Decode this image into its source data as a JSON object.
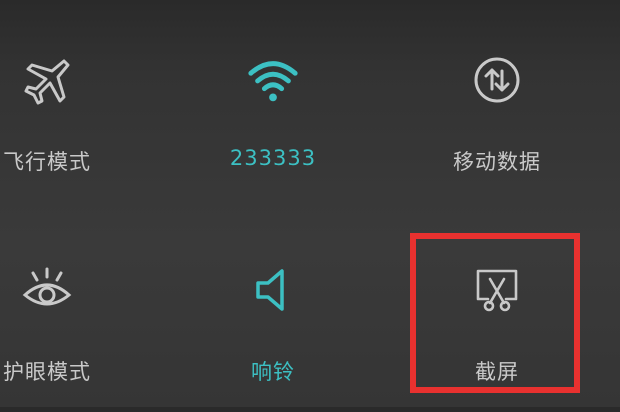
{
  "quick_settings": {
    "tiles": [
      {
        "label": "飞行模式",
        "icon": "airplane-icon",
        "active": false
      },
      {
        "label": "233333",
        "icon": "wifi-icon",
        "active": true
      },
      {
        "label": "移动数据",
        "icon": "mobile-data-icon",
        "active": false
      },
      {
        "label": "护眼模式",
        "icon": "eye-icon",
        "active": false
      },
      {
        "label": "响铃",
        "icon": "speaker-icon",
        "active": true
      },
      {
        "label": "截屏",
        "icon": "screenshot-icon",
        "active": false
      }
    ]
  },
  "colors": {
    "active": "#3cc0c3",
    "inactive": "#c9c9c9",
    "highlight": "#e8312f"
  }
}
